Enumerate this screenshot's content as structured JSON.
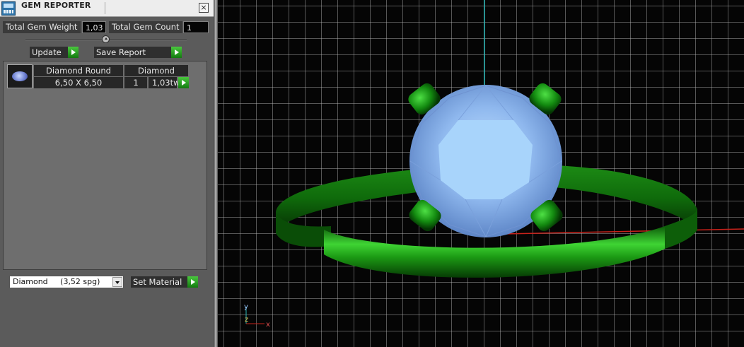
{
  "window": {
    "title": "GEM REPORTER",
    "close_label": "×"
  },
  "summary": {
    "total_weight_label": "Total Gem Weight",
    "total_weight_value": "1,03",
    "total_count_label": "Total Gem Count",
    "total_count_value": "1"
  },
  "actions": {
    "update_label": "Update",
    "save_report_label": "Save Report"
  },
  "gems": [
    {
      "icon": "round-gem-thumbnail",
      "shape": "Diamond Round",
      "material": "Diamond",
      "size": "6,50 X 6,50",
      "count": "1",
      "weight": "1,03tw"
    }
  ],
  "material": {
    "selected": "Diamond     (3,52 spg)",
    "set_label": "Set Material"
  },
  "viewport": {
    "axis_y": "y",
    "axis_z": "z",
    "axis_x": "x"
  },
  "colors": {
    "panel": "#5b5b5b",
    "accent_green": "#2fae2a",
    "ring_green": "#1f8f17",
    "gem_blue": "#8fb8ee",
    "axis_red": "#c8221b",
    "axis_cyan": "#2ab5b5"
  }
}
